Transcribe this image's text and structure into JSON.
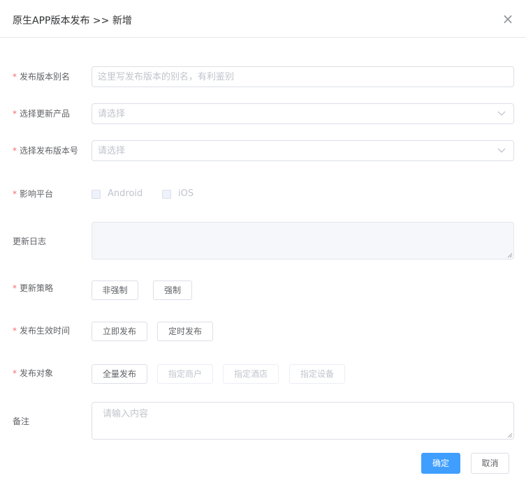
{
  "dialog": {
    "title": "原生APP版本发布 >> 新增",
    "close_icon": "close-icon"
  },
  "form": {
    "alias": {
      "label": "发布版本别名",
      "placeholder": "这里写发布版本的别名，有利鉴别"
    },
    "product": {
      "label": "选择更新产品",
      "placeholder": "请选择"
    },
    "version": {
      "label": "选择发布版本号",
      "placeholder": "请选择"
    },
    "platform": {
      "label": "影响平台",
      "options": [
        "Android",
        "iOS"
      ]
    },
    "changelog": {
      "label": "更新日志"
    },
    "strategy": {
      "label": "更新策略",
      "options": [
        "非强制",
        "强制"
      ]
    },
    "effective_time": {
      "label": "发布生效时间",
      "options": [
        "立即发布",
        "定时发布"
      ]
    },
    "target": {
      "label": "发布对象",
      "options": [
        "全量发布",
        "指定商户",
        "指定酒店",
        "指定设备"
      ]
    },
    "remark": {
      "label": "备注",
      "placeholder": "请输入内容"
    },
    "required_mark": "*"
  },
  "footer": {
    "confirm_label": "确定",
    "cancel_label": "取消"
  },
  "colors": {
    "primary": "#409eff",
    "required": "#f56c6c"
  }
}
